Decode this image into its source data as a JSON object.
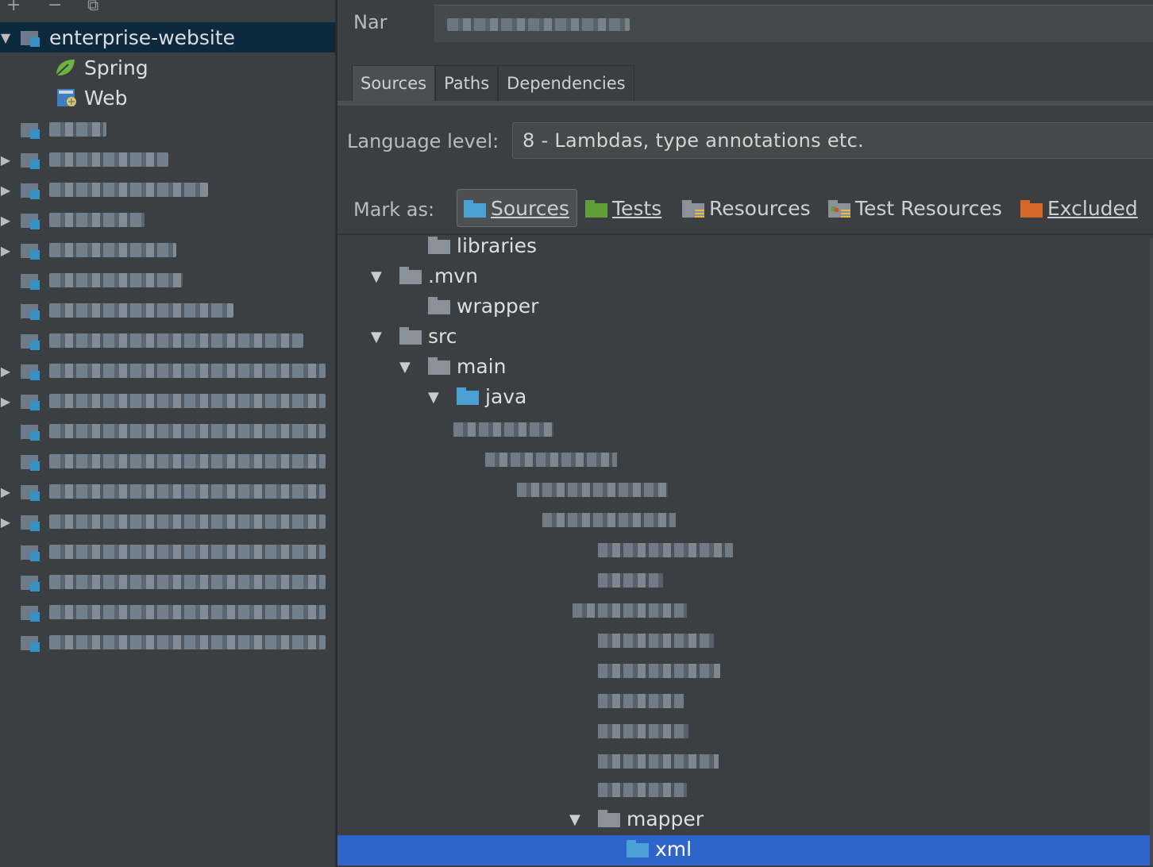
{
  "left_panel": {
    "toolbar": {
      "add": "+",
      "remove": "−",
      "copy": "⧉"
    },
    "modules": [
      {
        "label": "enterprise-website",
        "expanded": true,
        "selected": true
      },
      {
        "label": "Spring",
        "type": "facet-spring"
      },
      {
        "label": "Web",
        "type": "facet-web"
      }
    ]
  },
  "right_panel": {
    "name_label": "Nar",
    "tabs": [
      "Sources",
      "Paths",
      "Dependencies"
    ],
    "active_tab": "Sources",
    "language_level_label": "Language level:",
    "language_level_value": "8 - Lambdas, type annotations etc.",
    "mark_as_label": "Mark as:",
    "mark_buttons": [
      {
        "label": "Sources",
        "color": "#4ba0d6"
      },
      {
        "label": "Tests",
        "color": "#5e9f39"
      },
      {
        "label": "Resources",
        "color": "#8a9198"
      },
      {
        "label": "Test Resources",
        "color": "#8a9198"
      },
      {
        "label": "Excluded",
        "color": "#d46829"
      }
    ],
    "tree": [
      {
        "label": "libraries"
      },
      {
        "label": ".mvn"
      },
      {
        "label": "wrapper"
      },
      {
        "label": "src"
      },
      {
        "label": "main"
      },
      {
        "label": "java"
      },
      {
        "label": "mapper"
      },
      {
        "label": "xml"
      }
    ]
  }
}
